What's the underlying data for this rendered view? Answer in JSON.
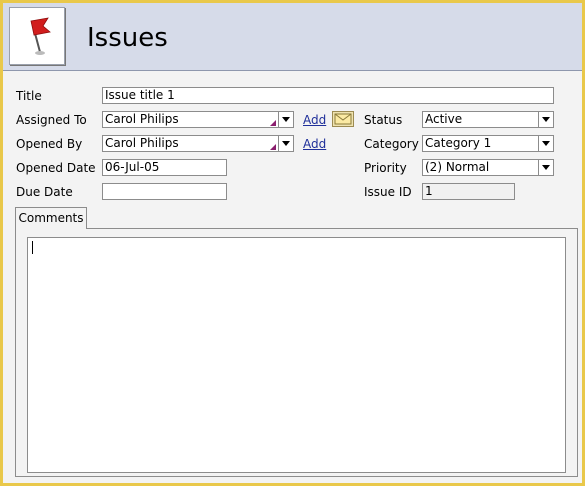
{
  "header": {
    "title": "Issues",
    "icon": "flag-icon"
  },
  "form": {
    "title": {
      "label": "Title",
      "value": "Issue title 1"
    },
    "assigned_to": {
      "label": "Assigned To",
      "value": "Carol Philips",
      "add_label": "Add",
      "mail_icon": "envelope-icon"
    },
    "opened_by": {
      "label": "Opened By",
      "value": "Carol Philips",
      "add_label": "Add"
    },
    "opened_date": {
      "label": "Opened Date",
      "value": "06-Jul-05"
    },
    "due_date": {
      "label": "Due Date",
      "value": ""
    },
    "status": {
      "label": "Status",
      "value": "Active"
    },
    "category": {
      "label": "Category",
      "value": "Category 1"
    },
    "priority": {
      "label": "Priority",
      "value": "(2) Normal"
    },
    "issue_id": {
      "label": "Issue ID",
      "value": "1"
    }
  },
  "tabs": [
    {
      "label": "Comments"
    }
  ],
  "colors": {
    "frame": "#e9c84a",
    "header_bg": "#d6dbe9",
    "link": "#1f2f9a"
  }
}
